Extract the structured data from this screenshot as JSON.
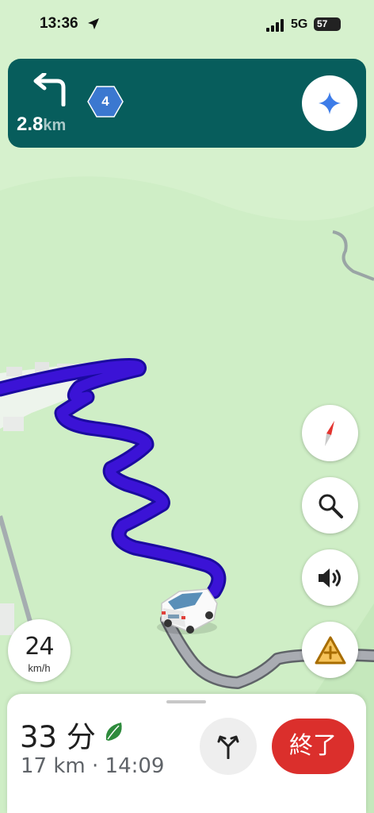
{
  "status_bar": {
    "time": "13:36",
    "network": "5G",
    "battery": "57"
  },
  "navigation": {
    "distance_value": "2.8",
    "distance_unit": "km",
    "route_number": "4",
    "turn_icon": "turn-left-arrow-icon",
    "assistant_icon": "sparkle-icon"
  },
  "map_controls": {
    "compass_icon": "compass-icon",
    "search_icon": "search-icon",
    "sound_icon": "speaker-icon",
    "report_icon": "report-incident-icon"
  },
  "speed": {
    "value": "24",
    "unit": "km/h"
  },
  "trip": {
    "duration": "33 分",
    "summary": "17 km · 14:09",
    "end_label": "終了",
    "alternate_routes_icon": "alternate-routes-icon"
  },
  "colors": {
    "route": "#3b13d6",
    "banner": "#075d5c",
    "end_button": "#db2f2c",
    "map_background": "#cfeec6"
  }
}
